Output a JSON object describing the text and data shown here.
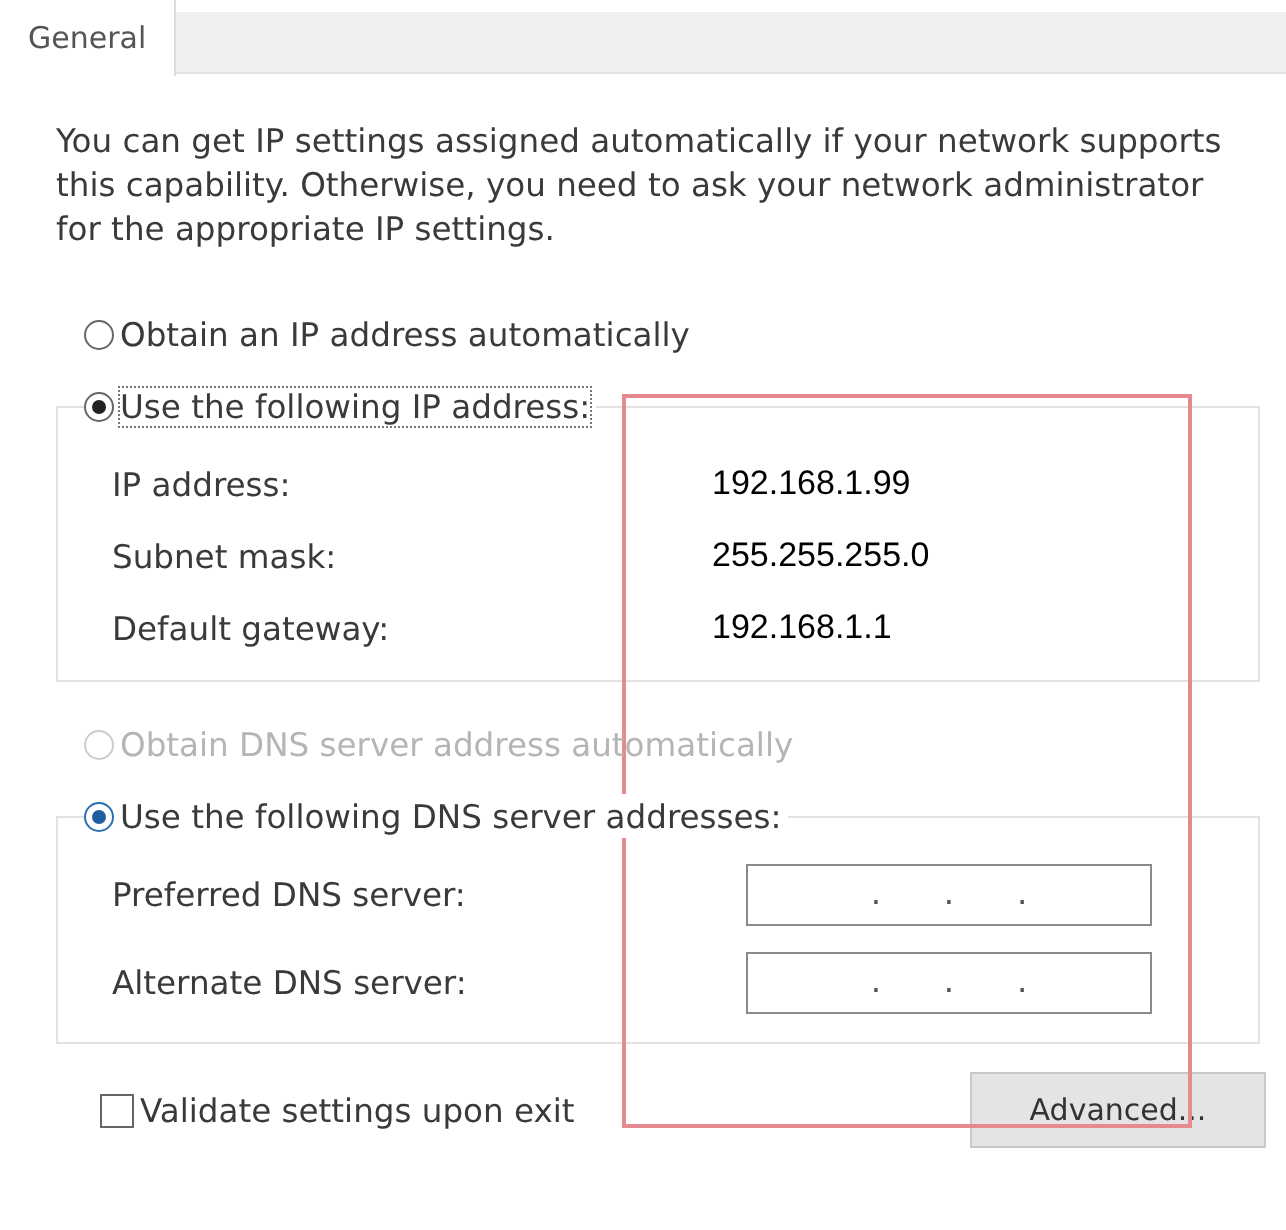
{
  "tabs": [
    {
      "label": "General",
      "selected": true
    }
  ],
  "description": "You can get IP settings assigned automatically if your network supports this capability. Otherwise, you need to ask your network administrator for the appropriate IP settings.",
  "ip_mode": [
    {
      "label": "Obtain an IP address automatically",
      "selected": false,
      "disabled": false
    },
    {
      "label": "Use the following IP address:",
      "selected": true,
      "disabled": false
    }
  ],
  "ip_fields": [
    {
      "label": "IP address:",
      "value": "192.168.1.99"
    },
    {
      "label": "Subnet mask:",
      "value": "255.255.255.0"
    },
    {
      "label": "Default gateway:",
      "value": "192.168.1.1"
    }
  ],
  "dns_mode": [
    {
      "label": "Obtain DNS server address automatically",
      "selected": false,
      "disabled": true
    },
    {
      "label": "Use the following DNS server addresses:",
      "selected": true,
      "disabled": false
    }
  ],
  "dns_fields": [
    {
      "label": "Preferred DNS server:",
      "separators": [
        ".",
        ".",
        "."
      ]
    },
    {
      "label": "Alternate DNS server:",
      "separators": [
        ".",
        ".",
        "."
      ]
    }
  ],
  "validate": {
    "label": "Validate settings upon exit",
    "checked": false
  },
  "advanced_button": "Advanced...",
  "highlight_frame": true
}
